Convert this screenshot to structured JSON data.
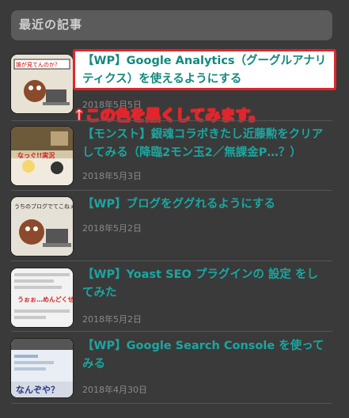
{
  "widget": {
    "title": "最近の記事"
  },
  "posts": [
    {
      "title": "【WP】Google Analytics（グーグルアナリティクス）を使えるようにする",
      "date": "2018年5月5日"
    },
    {
      "title": "【モンスト】銀魂コラボきたし近藤勲をクリアしてみる（降臨2モン玉2／無課金P…？）",
      "date": "2018年5月3日"
    },
    {
      "title": "【WP】ブログをググれるようにする",
      "date": "2018年5月2日"
    },
    {
      "title": "【WP】Yoast SEO プラグインの 設定 をしてみた",
      "date": "2018年5月2日"
    },
    {
      "title": "【WP】Google Search Console を使ってみる",
      "date": "2018年4月30日"
    }
  ],
  "thumbs": [
    {
      "caption": "誰が見てんのか？"
    },
    {
      "caption": "なっぐ!!実況"
    },
    {
      "caption": "うちのブログでてこねぇ？"
    },
    {
      "caption": "うぉぉ…めんどくせぇ！"
    },
    {
      "caption": "なんぞや？"
    }
  ],
  "annotation": {
    "text": "↑この色を黒くしてみます。"
  },
  "colors": {
    "link": "#1ba6a0",
    "highlight_border": "#e0262c",
    "background": "#3a3a3a"
  }
}
